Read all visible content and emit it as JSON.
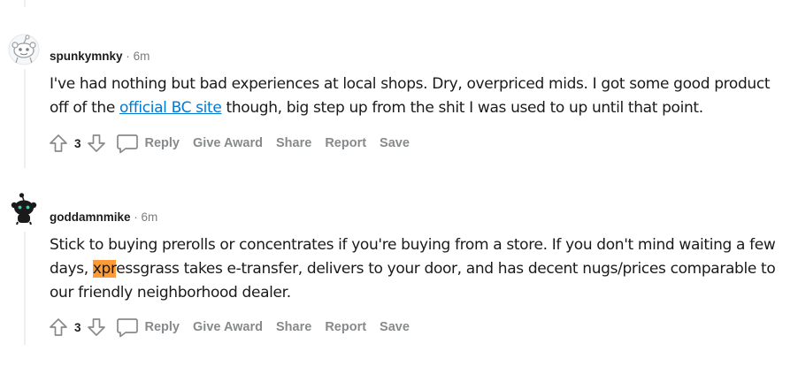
{
  "comments": [
    {
      "author": "spunkymnky",
      "separator": "·",
      "time": "6m",
      "body_before": "I've had nothing but bad experiences at local shops. Dry, overpriced mids. I got some good product off of the ",
      "link_text": "official BC site",
      "body_after": " though, big step up from the shit I was used to up until that point.",
      "score": "3",
      "actions": {
        "reply": "Reply",
        "award": "Give Award",
        "share": "Share",
        "report": "Report",
        "save": "Save"
      }
    },
    {
      "author": "goddamnmike",
      "separator": "·",
      "time": "6m",
      "body_before": "Stick to buying prerolls or concentrates if you're buying from a store. If you don't mind waiting a few days, ",
      "highlight_text": "xpr",
      "body_after": "essgrass takes e-transfer, delivers to your door, and has decent nugs/prices comparable to our friendly neighborhood dealer.",
      "score": "3",
      "actions": {
        "reply": "Reply",
        "award": "Give Award",
        "share": "Share",
        "report": "Report",
        "save": "Save"
      }
    }
  ],
  "colors": {
    "link": "#0079d3",
    "highlight": "#ff9b36",
    "muted": "#878a8c",
    "thread_line": "#edeff1"
  },
  "icons": [
    "upvote-icon",
    "downvote-icon",
    "comment-bubble-icon",
    "snoo-avatar-icon"
  ]
}
